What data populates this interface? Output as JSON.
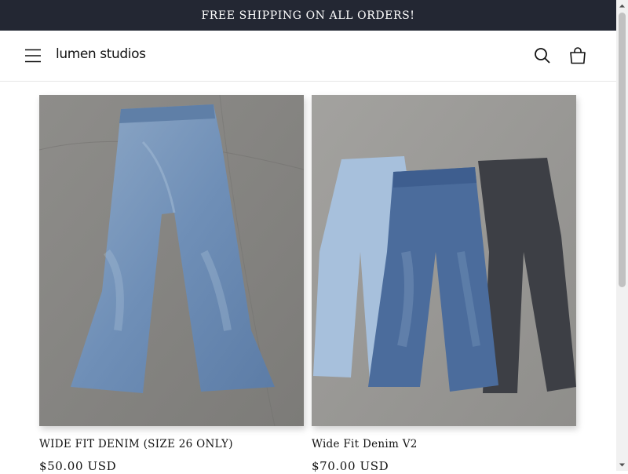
{
  "announcement": {
    "text": "FREE SHIPPING ON ALL ORDERS!"
  },
  "header": {
    "logo": "lumen studios",
    "icons": {
      "menu": "hamburger-menu-icon",
      "search": "search-icon",
      "cart": "shopping-bag-icon"
    }
  },
  "products": [
    {
      "title": "WIDE FIT DENIM (SIZE 26 ONLY)",
      "price": "$50.00 USD",
      "image": "light-wash-wide-fit-jeans"
    },
    {
      "title": "Wide Fit Denim V2",
      "price": "$70.00 USD",
      "image": "three-wide-fit-jeans-light-mid-black"
    }
  ],
  "colors": {
    "announcement_bg": "#232733",
    "announcement_text": "#ffffff",
    "text": "#121212",
    "divider": "#e6e6e6"
  }
}
